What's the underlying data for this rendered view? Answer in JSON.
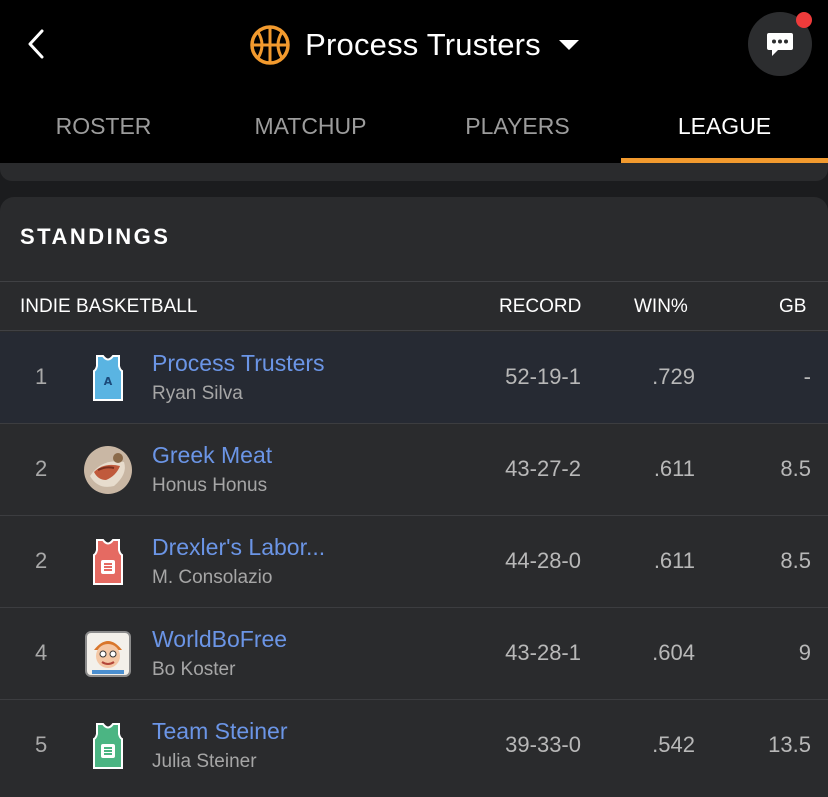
{
  "header": {
    "title": "Process Trusters",
    "brand_color": "#f29a2e",
    "notification_color": "#ee3b3b"
  },
  "tabs": [
    {
      "label": "ROSTER",
      "active": false
    },
    {
      "label": "MATCHUP",
      "active": false
    },
    {
      "label": "PLAYERS",
      "active": false
    },
    {
      "label": "LEAGUE",
      "active": true
    }
  ],
  "standings": {
    "title": "STANDINGS",
    "league_name": "INDIE BASKETBALL",
    "columns": {
      "record": "RECORD",
      "win_pct": "WIN%",
      "gb": "GB"
    },
    "rows": [
      {
        "rank": "1",
        "team": "Process Trusters",
        "owner": "Ryan Silva",
        "record": "52-19-1",
        "win_pct": ".729",
        "gb": "-",
        "avatar": "jersey-blue-icon",
        "highlight": true
      },
      {
        "rank": "2",
        "team": "Greek Meat",
        "owner": "Honus Honus",
        "record": "43-27-2",
        "win_pct": ".611",
        "gb": "8.5",
        "avatar": "food-photo-avatar",
        "highlight": false
      },
      {
        "rank": "2",
        "team": "Drexler's Labor...",
        "owner": "M. Consolazio",
        "record": "44-28-0",
        "win_pct": ".611",
        "gb": "8.5",
        "avatar": "jersey-red-icon",
        "highlight": false
      },
      {
        "rank": "4",
        "team": "WorldBoFree",
        "owner": "Bo Koster",
        "record": "43-28-1",
        "win_pct": ".604",
        "gb": "9",
        "avatar": "cartoon-face-avatar",
        "highlight": false
      },
      {
        "rank": "5",
        "team": "Team Steiner",
        "owner": "Julia Steiner",
        "record": "39-33-0",
        "win_pct": ".542",
        "gb": "13.5",
        "avatar": "jersey-green-icon",
        "highlight": false
      }
    ]
  }
}
